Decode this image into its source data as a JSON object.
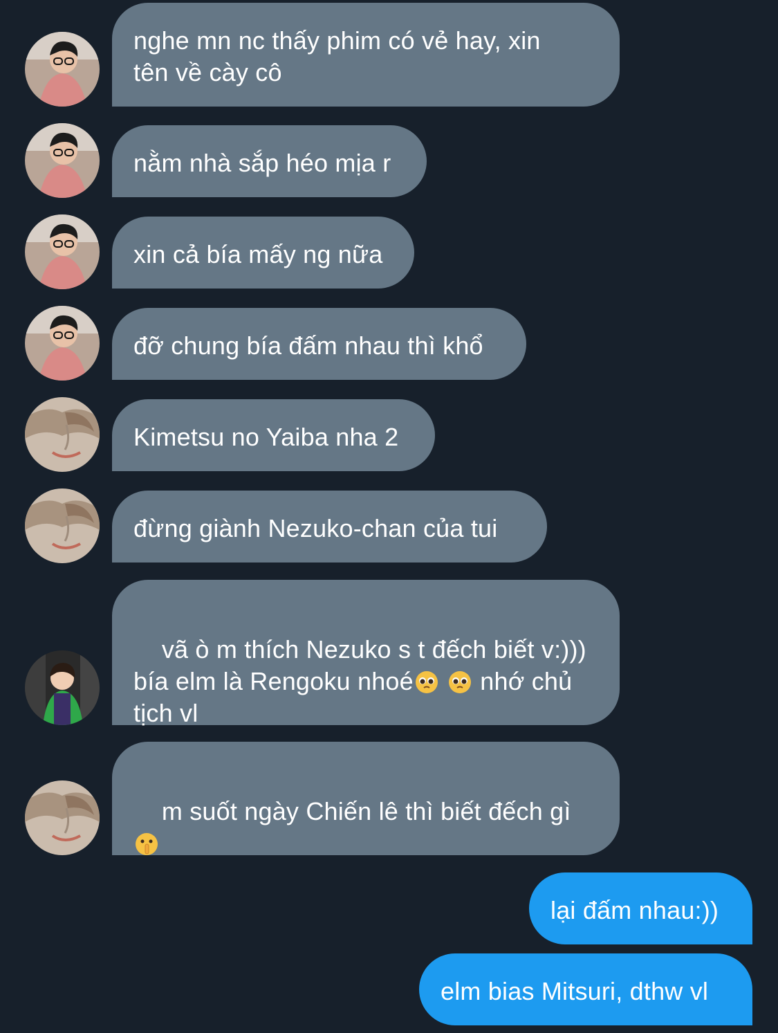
{
  "messages": [
    {
      "text": "nghe mn nc thấy phim có vẻ hay, xin\ntên về cày cô",
      "avatar": "user-a-avatar"
    },
    {
      "text": "nằm nhà sắp héo mịa r",
      "avatar": "user-a-avatar"
    },
    {
      "text": "xin cả bía mấy ng nữa",
      "avatar": "user-a-avatar"
    },
    {
      "text": "đỡ chung bía đấm nhau thì khổ",
      "avatar": "user-a-avatar"
    },
    {
      "text": "Kimetsu no Yaiba nha 2",
      "avatar": "user-b-avatar"
    },
    {
      "text": "đừng giành Nezuko-chan của tui",
      "avatar": "user-b-avatar"
    },
    {
      "text_line1": "vã ò m thích Nezuko s t đếch biết v:)))",
      "text_line2a": "bía elm là Rengoku nhoé",
      "text_line2b": " nhớ chủ",
      "text_line3": "tịch vl",
      "emojis": [
        "pleading-face-emoji",
        "pleading-face-emoji"
      ],
      "avatar": "user-c-avatar"
    },
    {
      "text": "m suốt ngày Chiến lê thì biết đếch gì",
      "emojis": [
        "shushing-face-emoji"
      ],
      "avatar": "user-b-avatar"
    },
    {
      "text": "lại đấm nhau:))",
      "sender": "self"
    },
    {
      "text": "elm bias Mitsuri, dthw vl",
      "sender": "self"
    }
  ],
  "colors": {
    "background": "#17202b",
    "incoming_bubble": "#657786",
    "outgoing_bubble": "#1d9bf0",
    "text": "#ffffff"
  }
}
